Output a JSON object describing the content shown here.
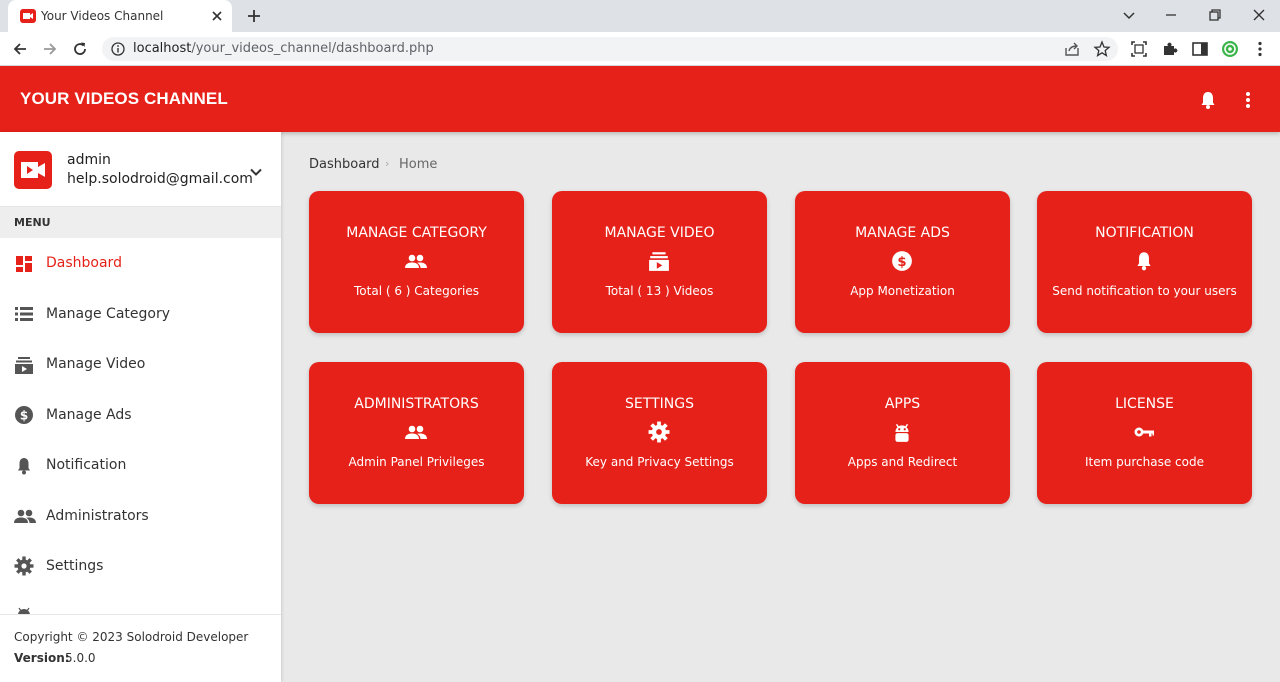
{
  "browser": {
    "tab_title": "Your Videos Channel",
    "url_host": "localhost",
    "url_path": "/your_videos_channel/dashboard.php"
  },
  "app": {
    "title": "YOUR VIDEOS CHANNEL",
    "brand_color": "#e52119"
  },
  "user": {
    "name": "admin",
    "email": "help.solodroid@gmail.com"
  },
  "sidebar": {
    "menu_header": "MENU",
    "items": [
      {
        "label": "Dashboard",
        "icon": "dashboard-icon",
        "active": true
      },
      {
        "label": "Manage Category",
        "icon": "list-icon"
      },
      {
        "label": "Manage Video",
        "icon": "video-library-icon"
      },
      {
        "label": "Manage Ads",
        "icon": "dollar-icon"
      },
      {
        "label": "Notification",
        "icon": "bell-icon"
      },
      {
        "label": "Administrators",
        "icon": "people-icon"
      },
      {
        "label": "Settings",
        "icon": "gear-icon"
      }
    ]
  },
  "footer": {
    "copyright": "Copyright © 2023 Solodroid Developer",
    "version_label": "Version:",
    "version_value": "5.0.0"
  },
  "breadcrumb": [
    "Dashboard",
    "Home"
  ],
  "cards": [
    {
      "title": "MANAGE CATEGORY",
      "subtitle": "Total ( 6 ) Categories",
      "icon": "people-icon"
    },
    {
      "title": "MANAGE VIDEO",
      "subtitle": "Total ( 13 ) Videos",
      "icon": "video-library-icon"
    },
    {
      "title": "MANAGE ADS",
      "subtitle": "App Monetization",
      "icon": "dollar-icon"
    },
    {
      "title": "NOTIFICATION",
      "subtitle": "Send notification to your users",
      "icon": "bell-icon"
    },
    {
      "title": "ADMINISTRATORS",
      "subtitle": "Admin Panel Privileges",
      "icon": "people-icon"
    },
    {
      "title": "SETTINGS",
      "subtitle": "Key and Privacy Settings",
      "icon": "gear-icon"
    },
    {
      "title": "APPS",
      "subtitle": "Apps and Redirect",
      "icon": "android-icon"
    },
    {
      "title": "LICENSE",
      "subtitle": "Item purchase code",
      "icon": "key-icon"
    }
  ]
}
